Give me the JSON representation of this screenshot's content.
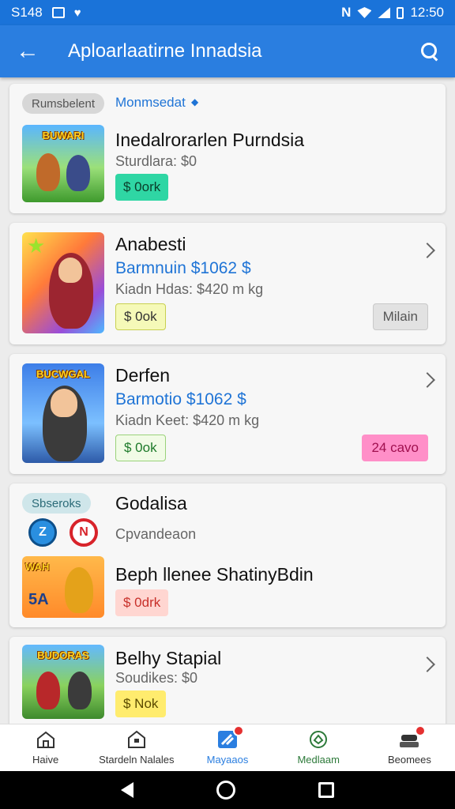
{
  "status_bar": {
    "time_left": "S148",
    "time_right": "12:50"
  },
  "app_bar": {
    "back_label": "←",
    "title": "Aploarlaatirne Innadsia"
  },
  "cards": [
    {
      "tag": "Rumsbelent",
      "link": "Monmsedat",
      "thumb_text": "BUWARI",
      "title": "Inedalrorarlen Purndsia",
      "subtitle": "Sturdlara: $0",
      "button": "$ 0ork"
    },
    {
      "title": "Anabesti",
      "price": "Barmnuin $1062 $",
      "subtitle": "Kiadn Hdas: $420 m kg",
      "button": "$ 0ok",
      "right_button": "Milain"
    },
    {
      "thumb_text": "BUCWGAL",
      "title": "Derfen",
      "price": "Barmotio $1062 $",
      "subtitle": "Kiadn Keet: $420 m kg",
      "button": "$ 0ok",
      "right_button": "24 cavo"
    },
    {
      "tag": "Sbseroks",
      "title": "Godalisa",
      "subtitle": "Cpvandeaon",
      "thumb_text": "WAH",
      "thumb_label": "5A",
      "title2": "Beph llenee ShatinyBdin",
      "button": "$ 0drk"
    },
    {
      "thumb_text": "BUDORAS",
      "title": "Belhy Stapial",
      "subtitle": "Soudikes: $0",
      "button": "$ Nok"
    }
  ],
  "bottom_nav": [
    {
      "label": "Haive"
    },
    {
      "label": "Stardeln Nalales"
    },
    {
      "label": "Mayaaos"
    },
    {
      "label": "Medlaam"
    },
    {
      "label": "Beomees"
    }
  ],
  "colors": {
    "primary": "#2a7ee0",
    "status": "#1a73d9",
    "price": "#1f74d6"
  }
}
